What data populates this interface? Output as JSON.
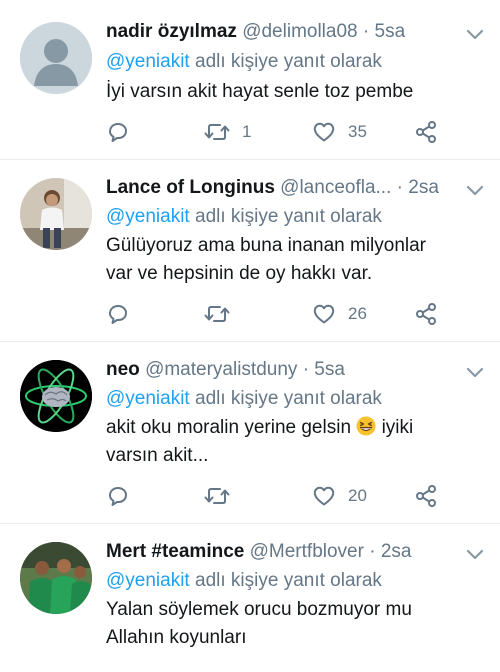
{
  "tweets": [
    {
      "display_name": "nadir özyılmaz",
      "handle": "@delimolla08",
      "separator": "·",
      "time": "5sa",
      "reply_prefix_mention": "@yeniakit",
      "reply_suffix": "adlı kişiye yanıt olarak",
      "text": "İyi varsın akit hayat senle toz pembe",
      "text_line2": "",
      "retweets": "1",
      "likes": "35",
      "avatar": "default-profile-avatar"
    },
    {
      "display_name": "Lance of Longinus",
      "handle": "@lanceofla...",
      "separator": "·",
      "time": "2sa",
      "reply_prefix_mention": "@yeniakit",
      "reply_suffix": "adlı kişiye yanıt olarak",
      "text": "Gülüyoruz ama buna inanan milyonlar",
      "text_line2": "var ve hepsinin de oy hakkı var.",
      "retweets": "",
      "likes": "26",
      "avatar": "photo-avatar-person"
    },
    {
      "display_name": "neo",
      "handle": "@materyalistduny",
      "separator": "·",
      "time": "5sa",
      "reply_prefix_mention": "@yeniakit",
      "reply_suffix": "adlı kişiye yanıt olarak",
      "text": "akit oku moralin yerine gelsin",
      "text_after_emoji": "iyiki",
      "text_line2": "varsın akit...",
      "emoji": "grinning-squinting-face",
      "retweets": "",
      "likes": "20",
      "avatar": "brain-atom-avatar"
    },
    {
      "display_name": "Mert #teamince",
      "handle": "@Mertfblover",
      "separator": "·",
      "time": "2sa",
      "reply_prefix_mention": "@yeniakit",
      "reply_suffix": "adlı kişiye yanıt olarak",
      "text": "Yalan söylemek orucu bozmuyor mu",
      "text_line2": "Allahın koyunları",
      "avatar": "football-team-avatar"
    }
  ],
  "colors": {
    "text_primary": "#14171a",
    "text_secondary": "#657786",
    "link": "#1da1f2",
    "divider": "#e6ecf0"
  }
}
